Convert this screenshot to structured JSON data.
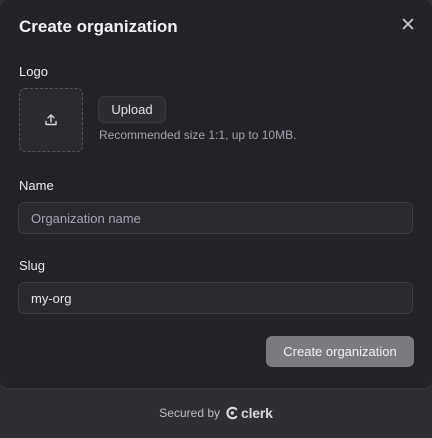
{
  "dialog": {
    "title": "Create organization"
  },
  "logo": {
    "label": "Logo",
    "upload_label": "Upload",
    "hint": "Recommended size 1:1, up to 10MB."
  },
  "name_field": {
    "label": "Name",
    "placeholder": "Organization name",
    "value": ""
  },
  "slug_field": {
    "label": "Slug",
    "placeholder": "",
    "value": "my-org"
  },
  "submit": {
    "label": "Create organization"
  },
  "footer": {
    "secured_text": "Secured by",
    "brand_name": "clerk"
  },
  "icons": {
    "close": "close-icon",
    "upload": "upload-icon",
    "brand": "clerk-logo-icon"
  },
  "colors": {
    "modal_background": "#232228",
    "page_background": "#2f2e35",
    "submit_background": "#7b7a80"
  }
}
